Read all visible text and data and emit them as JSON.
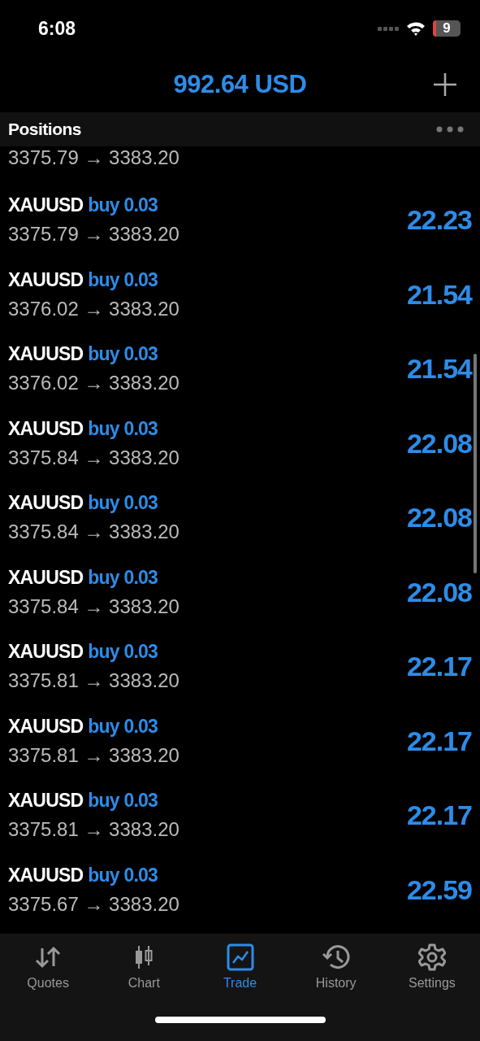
{
  "status_bar": {
    "time": "6:08",
    "battery": "9"
  },
  "header": {
    "balance": "992.64 USD"
  },
  "section": {
    "title": "Positions"
  },
  "partial_row": {
    "prices": "3375.79 → 3383.20"
  },
  "positions": [
    {
      "symbol": "XAUUSD",
      "side": "buy 0.03",
      "prices": "3375.79 → 3383.20",
      "profit": "22.23"
    },
    {
      "symbol": "XAUUSD",
      "side": "buy 0.03",
      "prices": "3376.02 → 3383.20",
      "profit": "21.54"
    },
    {
      "symbol": "XAUUSD",
      "side": "buy 0.03",
      "prices": "3376.02 → 3383.20",
      "profit": "21.54"
    },
    {
      "symbol": "XAUUSD",
      "side": "buy 0.03",
      "prices": "3375.84 → 3383.20",
      "profit": "22.08"
    },
    {
      "symbol": "XAUUSD",
      "side": "buy 0.03",
      "prices": "3375.84 → 3383.20",
      "profit": "22.08"
    },
    {
      "symbol": "XAUUSD",
      "side": "buy 0.03",
      "prices": "3375.84 → 3383.20",
      "profit": "22.08"
    },
    {
      "symbol": "XAUUSD",
      "side": "buy 0.03",
      "prices": "3375.81 → 3383.20",
      "profit": "22.17"
    },
    {
      "symbol": "XAUUSD",
      "side": "buy 0.03",
      "prices": "3375.81 → 3383.20",
      "profit": "22.17"
    },
    {
      "symbol": "XAUUSD",
      "side": "buy 0.03",
      "prices": "3375.81 → 3383.20",
      "profit": "22.17"
    },
    {
      "symbol": "XAUUSD",
      "side": "buy 0.03",
      "prices": "3375.67 → 3383.20",
      "profit": "22.59"
    }
  ],
  "tabs": [
    {
      "label": "Quotes",
      "selected": false
    },
    {
      "label": "Chart",
      "selected": false
    },
    {
      "label": "Trade",
      "selected": true
    },
    {
      "label": "History",
      "selected": false
    },
    {
      "label": "Settings",
      "selected": false
    }
  ]
}
